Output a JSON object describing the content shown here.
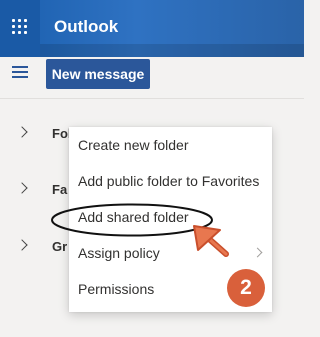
{
  "header": {
    "app_title": "Outlook",
    "brand_color": "#2b579a",
    "waffle_icon": "app-launcher-icon"
  },
  "toolbar": {
    "menu_icon": "hamburger-icon",
    "new_message_label": "New message"
  },
  "folders": [
    {
      "label": "Folders",
      "icon": "chevron-right-icon"
    },
    {
      "label": "Fa",
      "icon": "chevron-right-icon"
    },
    {
      "label": "Gr",
      "icon": "chevron-right-icon"
    }
  ],
  "context_menu": {
    "items": [
      {
        "label": "Create new folder",
        "has_submenu": false
      },
      {
        "label": "Add public folder to Favorites",
        "has_submenu": false
      },
      {
        "label": "Add shared folder",
        "has_submenu": false,
        "highlighted": true
      },
      {
        "label": "Assign policy",
        "has_submenu": true
      },
      {
        "label": "Permissions",
        "has_submenu": false
      }
    ]
  },
  "annotation": {
    "step_number": "2",
    "color": "#d9603b",
    "arrow_icon": "pointer-arrow-icon"
  }
}
